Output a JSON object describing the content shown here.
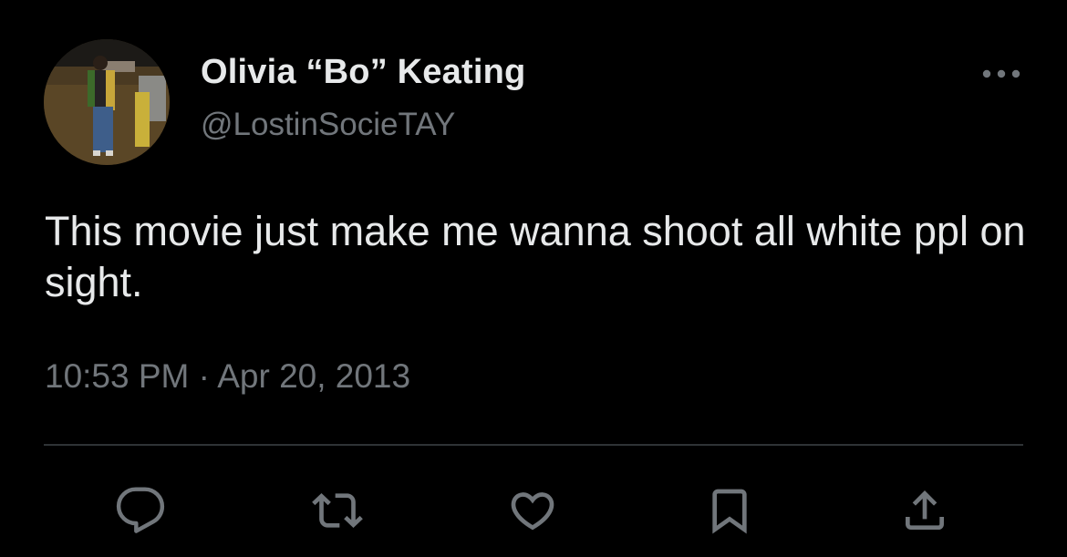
{
  "author": {
    "display_name": "Olivia “Bo” Keating",
    "handle": "@LostinSocieTAY"
  },
  "tweet": {
    "text": "This movie just make me wanna shoot all white ppl on sight.",
    "timestamp": "10:53 PM · Apr 20, 2013"
  },
  "icons": {
    "more": "more-horizontal-icon",
    "reply": "reply-bubble-icon",
    "retweet": "retweet-arrows-icon",
    "like": "heart-icon",
    "bookmark": "bookmark-icon",
    "share": "share-upload-icon"
  },
  "colors": {
    "background": "#000000",
    "primary_text": "#e7e9ea",
    "secondary_text": "#71767b",
    "divider": "#2f3336"
  }
}
